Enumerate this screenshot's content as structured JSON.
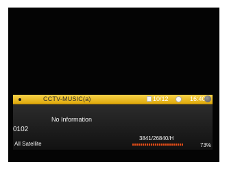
{
  "channel": {
    "name": "CCTV-MUSIC(a)",
    "number": "0102",
    "program_info": "No Information"
  },
  "header": {
    "date": "10/12",
    "time": "16:40"
  },
  "satellite": "All Satellite",
  "transponder": "3841/26840/H",
  "signal": {
    "percent_label": "73%",
    "level": 0.73
  },
  "icons": [
    "favorite-dot-icon",
    "calendar-icon",
    "clock-icon",
    "info-icon"
  ],
  "colors": {
    "header_bar": "#f0c030",
    "body_bar": "#1e1e1e",
    "signal_bar": "#e24d1a"
  }
}
